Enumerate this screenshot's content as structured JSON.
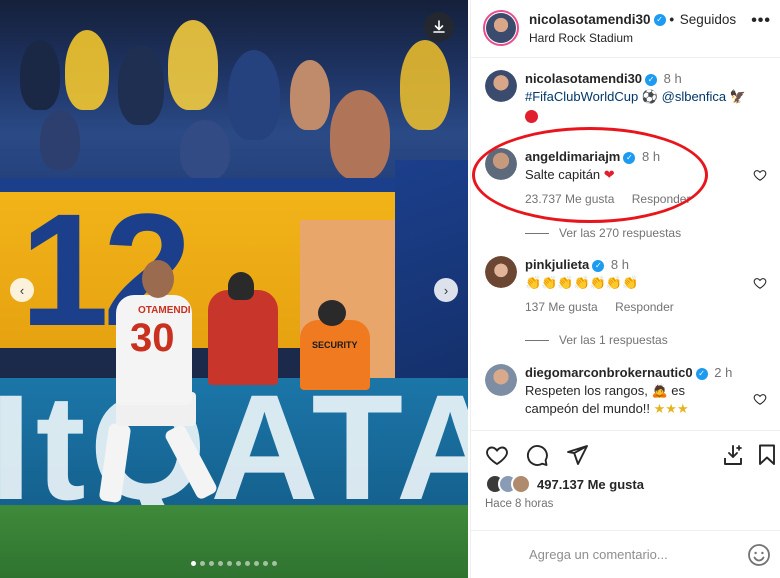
{
  "post": {
    "author": "nicolasotamendi30",
    "follow_status": "Seguidos",
    "location": "Hard Rock Stadium",
    "caption": {
      "user": "nicolasotamendi30",
      "time": "8 h",
      "text_link1": "#FifaClubWorldCup",
      "text_link2": "@slbenfica"
    },
    "likes": "497.137 Me gusta",
    "time_ago": "Hace 8 horas",
    "comment_placeholder": "Agrega un comentario...",
    "image": {
      "jersey_name": "OTAMENDI",
      "jersey_number": "30",
      "banner_number": "12",
      "board_text": "ItQATA",
      "security_label": "SECURITY",
      "slide_count": 10,
      "active_slide": 0
    }
  },
  "comments": [
    {
      "user": "angeldimariajm",
      "time": "8 h",
      "text": "Salte capitán",
      "likes": "23.737 Me gusta",
      "reply": "Responder",
      "view_replies": "Ver las 270 respuestas"
    },
    {
      "user": "pinkjulieta",
      "time": "8 h",
      "likes": "137 Me gusta",
      "reply": "Responder",
      "view_replies": "Ver las 1 respuestas"
    },
    {
      "user": "diegomarconbrokernautic0",
      "time": "2 h",
      "text_line1": "Respeten los rangos,",
      "text_line1b": "es",
      "text_line2": "campeón del mundo!!"
    }
  ],
  "icons": {
    "more": "more-icon",
    "download": "download-icon",
    "heart": "heart-icon",
    "comment": "comment-icon",
    "share": "share-icon",
    "save": "bookmark-icon",
    "emoji": "emoji-icon"
  },
  "colors": {
    "verified": "#1d9bf0",
    "highlight": "#e8161c",
    "link": "#00376b"
  }
}
